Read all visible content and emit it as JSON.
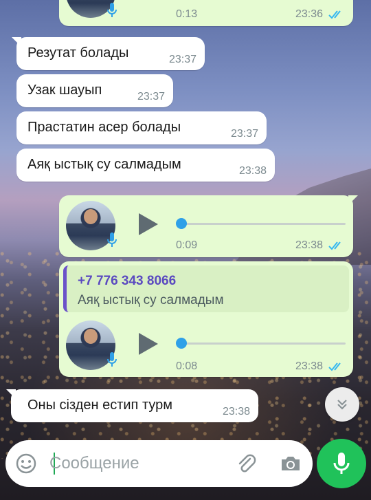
{
  "messages": [
    {
      "kind": "voice-out-top",
      "duration": "0:13",
      "time": "23:36"
    },
    {
      "kind": "text-in",
      "text": "Резутат болады",
      "time": "23:37"
    },
    {
      "kind": "text-in",
      "text": "Узак шауып",
      "time": "23:37"
    },
    {
      "kind": "text-in",
      "text": "Прастатин асер болады",
      "time": "23:37"
    },
    {
      "kind": "text-in",
      "text": "Аяқ ыстық су салмадым",
      "time": "23:38"
    },
    {
      "kind": "voice-out",
      "duration": "0:09",
      "time": "23:38"
    },
    {
      "kind": "voice-out-reply",
      "reply_name": "+7 776 343 8066",
      "reply_text": "Аяқ ыстық су салмадым",
      "duration": "0:08",
      "time": "23:38"
    },
    {
      "kind": "text-in",
      "text": "Оны сізден естип турм",
      "time": "23:38"
    }
  ],
  "composer": {
    "placeholder": "Сообщение"
  },
  "icons": {
    "emoji": "emoji-icon",
    "attach": "paperclip-icon",
    "camera": "camera-icon",
    "mic": "microphone-icon",
    "scroll": "double-chevron-down-icon",
    "read": "double-check-icon"
  },
  "colors": {
    "outgoing": "#e6fbd2",
    "incoming": "#ffffff",
    "accent": "#20c25a",
    "read_ticks": "#34b7f1",
    "reply_name": "#5a49c0"
  }
}
